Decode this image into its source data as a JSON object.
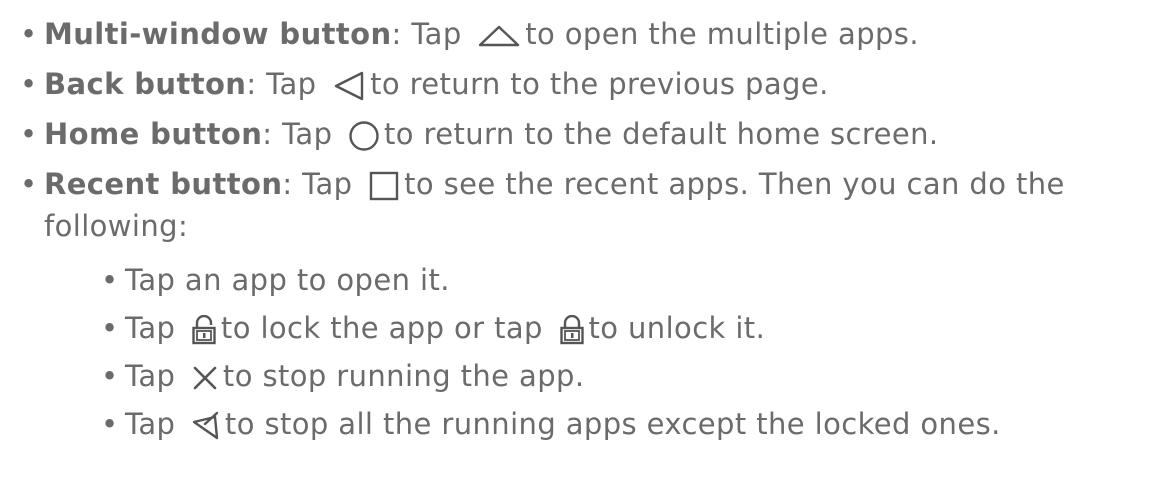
{
  "items": [
    {
      "title": "Multi-window button",
      "sep": ": ",
      "pre": "Tap",
      "post": "to open the multiple apps.",
      "icon": "multi-window-icon"
    },
    {
      "title": "Back button",
      "sep": ": ",
      "pre": "Tap",
      "post": "to return to the previous page.",
      "icon": "back-triangle-icon"
    },
    {
      "title": "Home button",
      "sep": ": ",
      "pre": "Tap",
      "post": "to return to the default home screen.",
      "icon": "home-circle-icon"
    },
    {
      "title": "Recent button",
      "sep": ": ",
      "pre": "Tap",
      "post": "to see the recent apps. Then you can do the",
      "cont": "following:",
      "icon": "recent-square-icon"
    }
  ],
  "subitems": [
    {
      "text": "Tap an app to open it."
    },
    {
      "pre": "Tap",
      "mid": "to lock the app or tap",
      "post": "to unlock it.",
      "icon1": "lock-open-icon",
      "icon2": "lock-closed-icon"
    },
    {
      "pre": "Tap",
      "post": "to stop running the app.",
      "icon": "close-x-icon"
    },
    {
      "pre": "Tap",
      "post": "to stop all the running apps except the locked ones.",
      "icon": "broom-icon"
    }
  ],
  "bullet": "•",
  "colors": {
    "text": "#6b6b6b",
    "icon": "#555555"
  }
}
